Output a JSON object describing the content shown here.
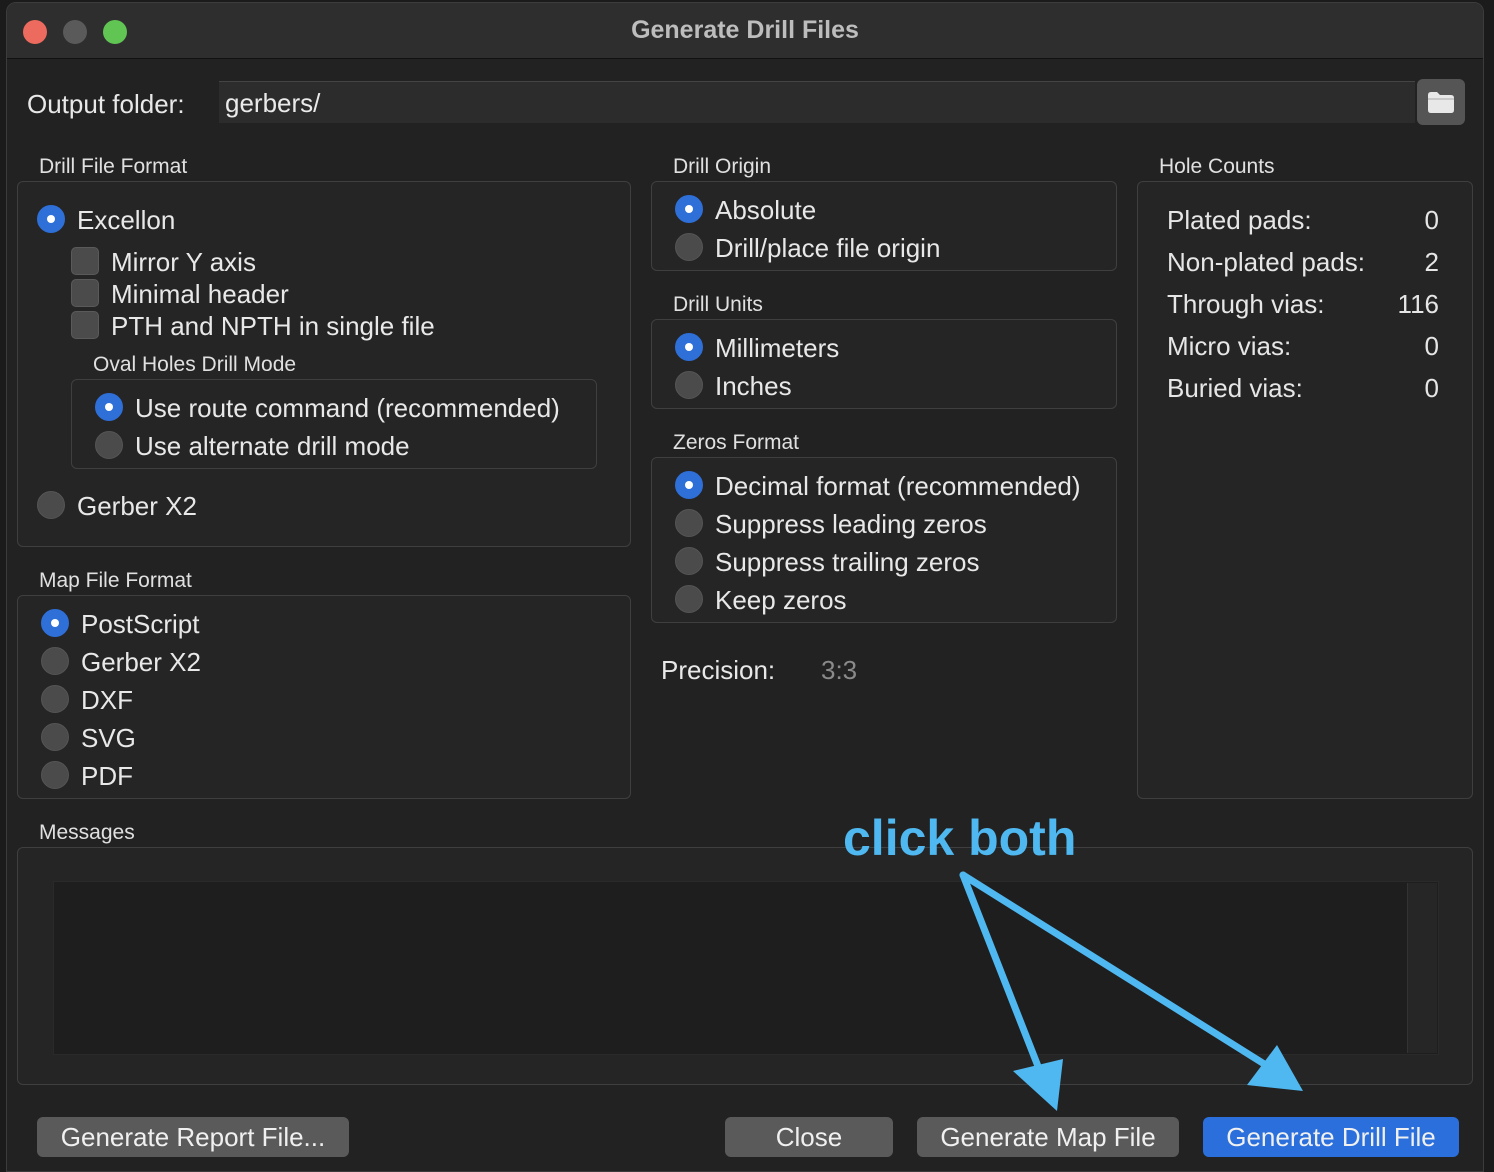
{
  "window": {
    "title": "Generate Drill Files"
  },
  "output": {
    "label": "Output folder:",
    "value": "gerbers/",
    "browse_icon": "folder-icon"
  },
  "drill_file_format": {
    "title": "Drill File Format",
    "excellon": "Excellon",
    "mirror_y": "Mirror Y axis",
    "minimal_header": "Minimal header",
    "pth_npth_single": "PTH and NPTH in single file",
    "oval_title": "Oval Holes Drill Mode",
    "route_command": "Use route command (recommended)",
    "alternate_mode": "Use alternate drill mode",
    "gerber_x2": "Gerber X2",
    "selected": "Excellon",
    "oval_selected": "Use route command (recommended)"
  },
  "map_file_format": {
    "title": "Map File Format",
    "options": [
      "PostScript",
      "Gerber X2",
      "DXF",
      "SVG",
      "PDF"
    ],
    "selected": "PostScript"
  },
  "drill_origin": {
    "title": "Drill Origin",
    "options": [
      "Absolute",
      "Drill/place file origin"
    ],
    "selected": "Absolute"
  },
  "drill_units": {
    "title": "Drill Units",
    "options": [
      "Millimeters",
      "Inches"
    ],
    "selected": "Millimeters"
  },
  "zeros_format": {
    "title": "Zeros Format",
    "options": [
      "Decimal format (recommended)",
      "Suppress leading zeros",
      "Suppress trailing zeros",
      "Keep zeros"
    ],
    "selected": "Decimal format (recommended)"
  },
  "precision": {
    "label": "Precision:",
    "value": "3:3"
  },
  "hole_counts": {
    "title": "Hole Counts",
    "rows": [
      {
        "label": "Plated pads:",
        "value": "0"
      },
      {
        "label": "Non-plated pads:",
        "value": "2"
      },
      {
        "label": "Through vias:",
        "value": "116"
      },
      {
        "label": "Micro vias:",
        "value": "0"
      },
      {
        "label": "Buried vias:",
        "value": "0"
      }
    ]
  },
  "messages": {
    "title": "Messages"
  },
  "buttons": {
    "report": "Generate Report File...",
    "close": "Close",
    "map": "Generate Map File",
    "drill": "Generate Drill File"
  },
  "annotation": {
    "text": "click both",
    "color": "#4fb8f0"
  },
  "colors": {
    "accent": "#2a6fdb",
    "background": "#222222"
  }
}
